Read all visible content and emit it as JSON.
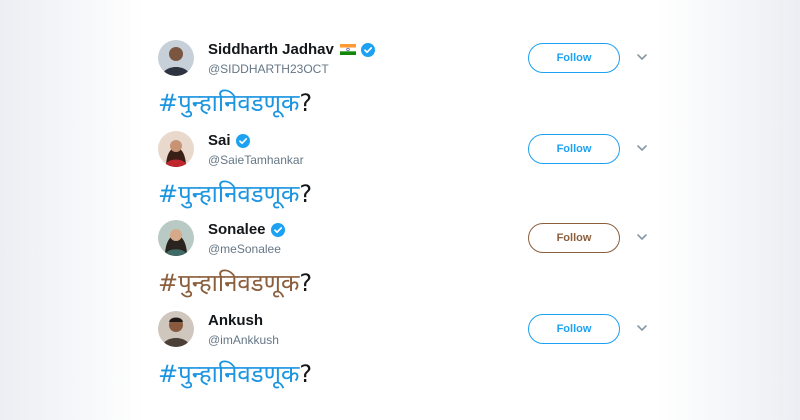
{
  "follow_label": "Follow",
  "accent_color": "#1da1f2",
  "tweets": [
    {
      "name": "Siddharth Jadhav",
      "handle": "@SIDDHARTH23OCT",
      "has_flag": true,
      "flag_icon": "india-flag-icon",
      "verified": true,
      "hashtag": "#पुन्हानिवडणूक",
      "suffix": "?"
    },
    {
      "name": "Sai",
      "handle": "@SaieTamhankar",
      "verified": true,
      "hashtag": "#पुन्हानिवडणूक",
      "suffix": "?"
    },
    {
      "name": "Sonalee",
      "handle": "@meSonalee",
      "verified": true,
      "hashtag": "#पुन्हानिवडणूक",
      "suffix": "?",
      "hashtag_color": "#8b5e3c"
    },
    {
      "name": "Ankush",
      "handle": "@imAnkkush",
      "verified": false,
      "hashtag": "#पुन्हानिवडणूक",
      "suffix": "?"
    }
  ]
}
